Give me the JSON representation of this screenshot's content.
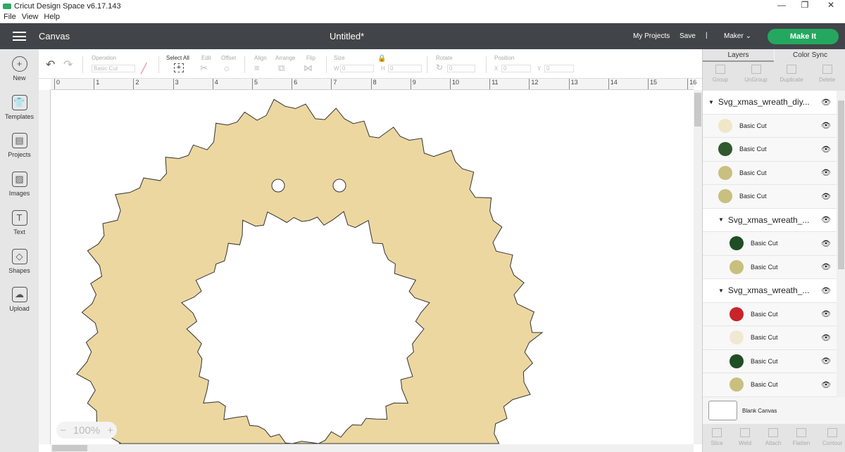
{
  "app": {
    "title": "Cricut Design Space  v6.17.143",
    "menu": [
      "File",
      "View",
      "Help"
    ]
  },
  "header": {
    "section": "Canvas",
    "doc_title": "Untitled*",
    "my_projects": "My Projects",
    "save": "Save",
    "divider": "|",
    "machine": "Maker",
    "make_it": "Make It"
  },
  "sidebar": [
    {
      "label": "New",
      "icon": "+"
    },
    {
      "label": "Templates",
      "icon": "👕"
    },
    {
      "label": "Projects",
      "icon": "▤"
    },
    {
      "label": "Images",
      "icon": "▨"
    },
    {
      "label": "Text",
      "icon": "T"
    },
    {
      "label": "Shapes",
      "icon": "◇"
    },
    {
      "label": "Upload",
      "icon": "☁"
    }
  ],
  "toolbar": {
    "operation_label": "Operation",
    "operation_value": "Basic Cut",
    "select_all": "Select All",
    "edit": "Edit",
    "offset": "Offset",
    "align": "Align",
    "arrange": "Arrange",
    "flip": "Flip",
    "size": "Size",
    "w_label": "W",
    "w_value": "0",
    "h_label": "H",
    "h_value": "0",
    "rotate": "Rotate",
    "rotate_value": "0",
    "position": "Position",
    "x_label": "X",
    "x_value": "0",
    "y_label": "Y",
    "y_value": "0"
  },
  "ruler": [
    "0",
    "1",
    "2",
    "3",
    "4",
    "5",
    "6",
    "7",
    "8",
    "9",
    "10",
    "11",
    "12",
    "13",
    "14",
    "15",
    "16"
  ],
  "zoom": {
    "value": "100%",
    "minus": "−",
    "plus": "+"
  },
  "panel": {
    "tabs": [
      "Layers",
      "Color Sync"
    ],
    "actions": [
      "Group",
      "UnGroup",
      "Duplicate",
      "Delete"
    ],
    "layers": [
      {
        "type": "group",
        "label": "Svg_xmas_wreath_diy..."
      },
      {
        "type": "item",
        "label": "Basic Cut",
        "color": "#f0e6c8"
      },
      {
        "type": "item",
        "label": "Basic Cut",
        "color": "#2e5a2e"
      },
      {
        "type": "item",
        "label": "Basic Cut",
        "color": "#c9bf7e"
      },
      {
        "type": "item",
        "label": "Basic Cut",
        "color": "#c9bf7e"
      },
      {
        "type": "subgroup",
        "label": "Svg_xmas_wreath_..."
      },
      {
        "type": "subitem",
        "label": "Basic Cut",
        "color": "#1f4d24"
      },
      {
        "type": "subitem",
        "label": "Basic Cut",
        "color": "#c9bf7e"
      },
      {
        "type": "subgroup",
        "label": "Svg_xmas_wreath_..."
      },
      {
        "type": "subitem",
        "label": "Basic Cut",
        "color": "#c8242a"
      },
      {
        "type": "subitem",
        "label": "Basic Cut",
        "color": "#f1e8d2"
      },
      {
        "type": "subitem",
        "label": "Basic Cut",
        "color": "#1f4d24"
      },
      {
        "type": "subitem",
        "label": "Basic Cut",
        "color": "#c9bf7e"
      },
      {
        "type": "subgroup",
        "label": "Svg_xmas_wreath_..."
      }
    ],
    "blank_canvas": "Blank Canvas",
    "bottom_actions": [
      "Slice",
      "Weld",
      "Attach",
      "Flatten",
      "Contour"
    ]
  },
  "colors": {
    "wreath": "#ecd7a0",
    "header": "#414549",
    "accent": "#24a85f"
  }
}
